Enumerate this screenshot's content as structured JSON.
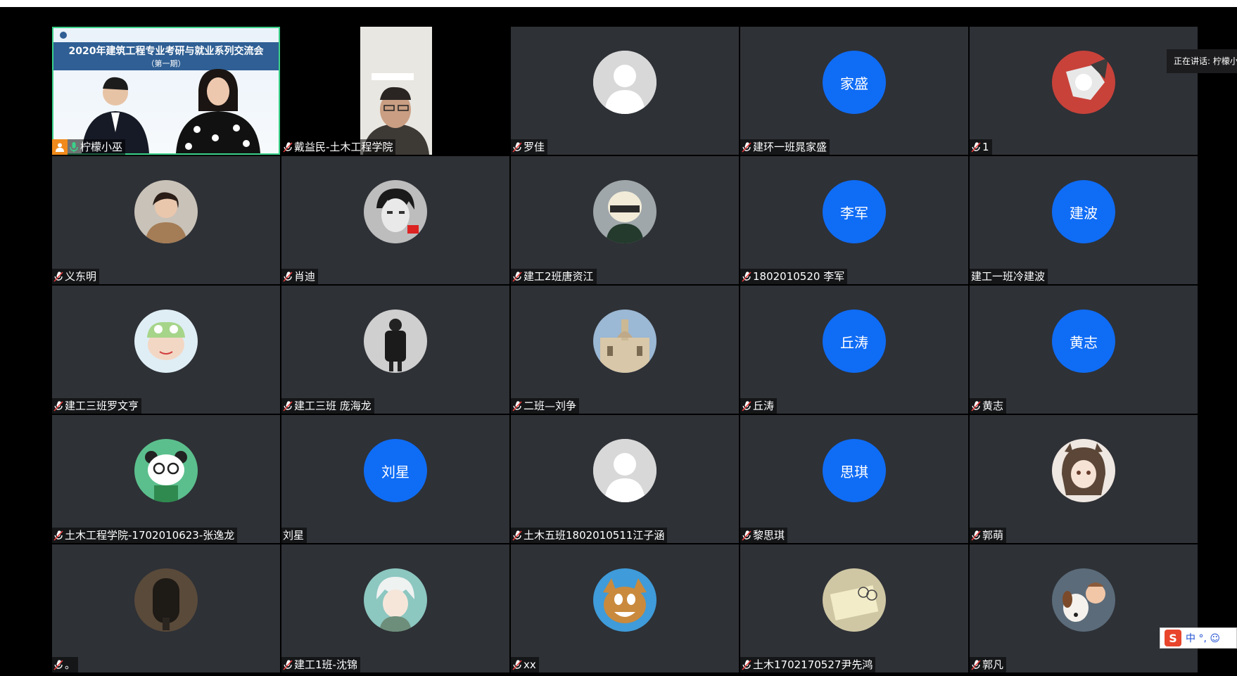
{
  "speaking_indicator": {
    "label": "正在讲话: 柠檬小"
  },
  "slide": {
    "title": "2020年建筑工程专业考研与就业系列交流会",
    "subtitle": "（第一期）"
  },
  "participants": [
    {
      "name": "柠檬小巫",
      "kind": "slide",
      "host": true,
      "mic": true
    },
    {
      "name": "戴益民-土木工程学院",
      "kind": "video",
      "mic": true
    },
    {
      "name": "罗佳",
      "kind": "default",
      "mic": true
    },
    {
      "name": "建环一班晁家盛",
      "kind": "text",
      "avatar_text": "家盛",
      "mic": true
    },
    {
      "name": "1",
      "kind": "photo",
      "photo": "bird",
      "mic": true
    },
    {
      "name": "义东明",
      "kind": "photo",
      "photo": "woman",
      "mic": true
    },
    {
      "name": "肖迪",
      "kind": "photo",
      "photo": "anime-boy",
      "mic": true
    },
    {
      "name": "建工2班唐资江",
      "kind": "photo",
      "photo": "helmet",
      "mic": true
    },
    {
      "name": "1802010520  李军",
      "kind": "text",
      "avatar_text": "李军",
      "mic": true
    },
    {
      "name": "建工一班冷建波",
      "kind": "text",
      "avatar_text": "建波",
      "mic": false
    },
    {
      "name": "建工三班罗文亨",
      "kind": "photo",
      "photo": "cartoon-frog",
      "mic": true
    },
    {
      "name": "建工三班 庞海龙",
      "kind": "photo",
      "photo": "backpack",
      "mic": true
    },
    {
      "name": "二班—刘争",
      "kind": "photo",
      "photo": "building",
      "mic": true
    },
    {
      "name": "丘涛",
      "kind": "text",
      "avatar_text": "丘涛",
      "mic": true
    },
    {
      "name": "黄志",
      "kind": "text",
      "avatar_text": "黄志",
      "mic": true
    },
    {
      "name": "土木工程学院-1702010623-张逸龙",
      "kind": "photo",
      "photo": "panda",
      "mic": true
    },
    {
      "name": "刘星",
      "kind": "text",
      "avatar_text": "刘星",
      "mic": false
    },
    {
      "name": "土木五班1802010511江子涵",
      "kind": "default",
      "mic": true
    },
    {
      "name": "黎思琪",
      "kind": "text",
      "avatar_text": "思琪",
      "mic": true
    },
    {
      "name": "郭萌",
      "kind": "photo",
      "photo": "anime-girl",
      "mic": true
    },
    {
      "name": "。",
      "kind": "photo",
      "photo": "dark-door",
      "mic": true
    },
    {
      "name": "建工1班-沈锦",
      "kind": "photo",
      "photo": "anime-white",
      "mic": true
    },
    {
      "name": "xx",
      "kind": "photo",
      "photo": "cartoon-cat",
      "mic": true
    },
    {
      "name": "土木1702170527尹先鸿",
      "kind": "photo",
      "photo": "notebook",
      "mic": true
    },
    {
      "name": "郭凡",
      "kind": "photo",
      "photo": "dog-baby",
      "mic": true
    }
  ],
  "ime": {
    "logo": "S",
    "text": "中 °, ☺"
  },
  "colors": {
    "tile_bg": "#2e3136",
    "text_avatar": "#0f6cf5",
    "active_border": "#3bd18a"
  }
}
